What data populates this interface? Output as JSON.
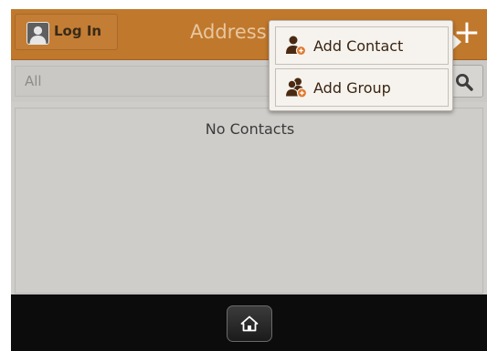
{
  "header": {
    "login_label": "Log In",
    "title": "Address",
    "add_symbol": "+"
  },
  "search": {
    "placeholder": "All",
    "value": ""
  },
  "contacts": {
    "empty_message": "No Contacts"
  },
  "add_menu": {
    "items": [
      {
        "label": "Add Contact",
        "icon": "person-add-icon"
      },
      {
        "label": "Add Group",
        "icon": "group-add-icon"
      }
    ]
  },
  "footer": {
    "home_icon": "home-icon"
  },
  "colors": {
    "header_bg": "#c0782c",
    "menu_icon": "#4a2a12",
    "badge_orange": "#e0792c",
    "panel_bg": "#cfcdca"
  }
}
